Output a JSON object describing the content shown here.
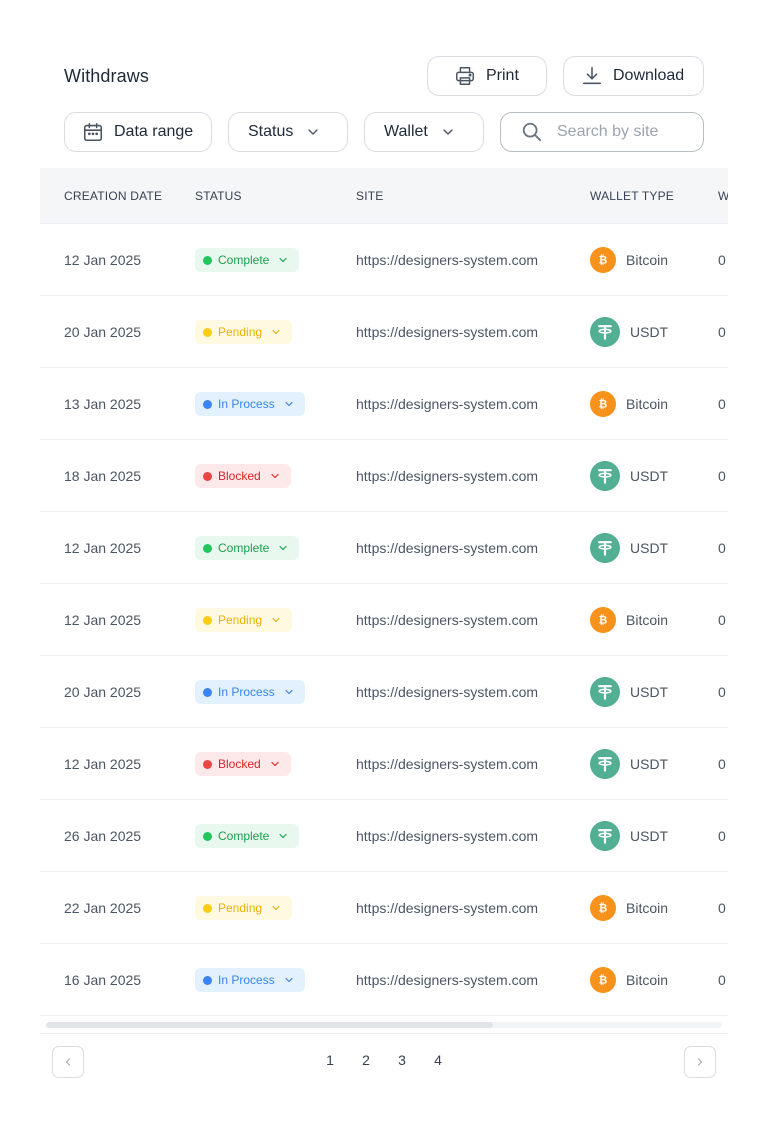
{
  "header": {
    "title": "Withdraws",
    "print_label": "Print",
    "download_label": "Download"
  },
  "filters": {
    "date_label": "Data range",
    "status_label": "Status",
    "wallet_label": "Wallet",
    "search_placeholder": "Search by site",
    "search_value": ""
  },
  "table": {
    "columns": [
      "CREATION DATE",
      "STATUS",
      "SITE",
      "WALLET TYPE",
      "W"
    ],
    "rows": [
      {
        "date": "12 Jan 2025",
        "status": "Complete",
        "status_key": "complete",
        "site": "https://designers-system.com",
        "wallet": "Bitcoin",
        "wallet_icon": "bitcoin-icon",
        "amount": "0"
      },
      {
        "date": "20 Jan 2025",
        "status": "Pending",
        "status_key": "pending",
        "site": "https://designers-system.com",
        "wallet": "USDT",
        "wallet_icon": "tether-icon",
        "amount": "0"
      },
      {
        "date": "13 Jan 2025",
        "status": "In Process",
        "status_key": "inprocess",
        "site": "https://designers-system.com",
        "wallet": "Bitcoin",
        "wallet_icon": "bitcoin-icon",
        "amount": "0"
      },
      {
        "date": "18 Jan 2025",
        "status": "Blocked",
        "status_key": "blocked",
        "site": "https://designers-system.com",
        "wallet": "USDT",
        "wallet_icon": "tether-icon",
        "amount": "0"
      },
      {
        "date": "12 Jan 2025",
        "status": "Complete",
        "status_key": "complete",
        "site": "https://designers-system.com",
        "wallet": "USDT",
        "wallet_icon": "tether-icon",
        "amount": "0"
      },
      {
        "date": "12 Jan 2025",
        "status": "Pending",
        "status_key": "pending",
        "site": "https://designers-system.com",
        "wallet": "Bitcoin",
        "wallet_icon": "bitcoin-icon",
        "amount": "0"
      },
      {
        "date": "20 Jan 2025",
        "status": "In Process",
        "status_key": "inprocess",
        "site": "https://designers-system.com",
        "wallet": "USDT",
        "wallet_icon": "tether-icon",
        "amount": "0"
      },
      {
        "date": "12 Jan 2025",
        "status": "Blocked",
        "status_key": "blocked",
        "site": "https://designers-system.com",
        "wallet": "USDT",
        "wallet_icon": "tether-icon",
        "amount": "0"
      },
      {
        "date": "26 Jan 2025",
        "status": "Complete",
        "status_key": "complete",
        "site": "https://designers-system.com",
        "wallet": "USDT",
        "wallet_icon": "tether-icon",
        "amount": "0"
      },
      {
        "date": "22 Jan 2025",
        "status": "Pending",
        "status_key": "pending",
        "site": "https://designers-system.com",
        "wallet": "Bitcoin",
        "wallet_icon": "bitcoin-icon",
        "amount": "0"
      },
      {
        "date": "16 Jan 2025",
        "status": "In Process",
        "status_key": "inprocess",
        "site": "https://designers-system.com",
        "wallet": "Bitcoin",
        "wallet_icon": "bitcoin-icon",
        "amount": "0"
      }
    ]
  },
  "pagination": {
    "pages": [
      "1",
      "2",
      "3",
      "4"
    ]
  },
  "colors": {
    "complete": "#16a34a",
    "pending": "#eab308",
    "in_process": "#3b82f6",
    "blocked": "#dc2626",
    "bitcoin": "#f7931a",
    "usdt": "#53ae94"
  }
}
